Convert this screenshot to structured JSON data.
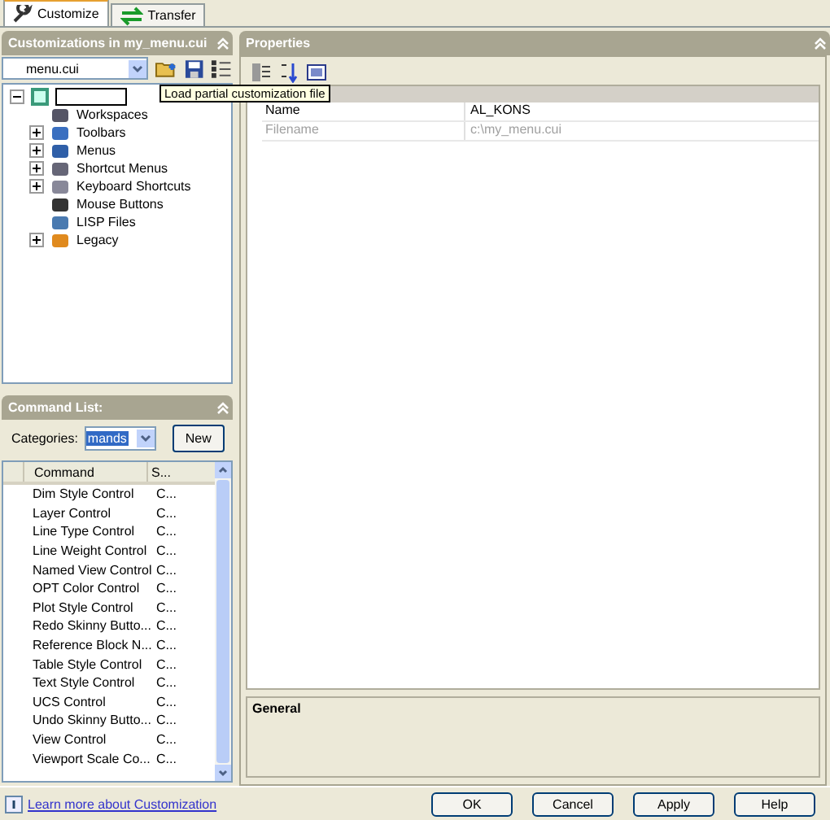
{
  "tabs": [
    {
      "label": "Customize",
      "selected": true
    },
    {
      "label": "Transfer",
      "selected": false
    }
  ],
  "customizations": {
    "title": "Customizations in my_menu.cui",
    "file_combo": {
      "value": "menu.cui"
    },
    "tooltip": "Load partial customization file",
    "tree": {
      "expanded": true,
      "children": [
        {
          "label": "Workspaces",
          "kind": "leaf"
        },
        {
          "label": "Toolbars",
          "kind": "group"
        },
        {
          "label": "Menus",
          "kind": "group"
        },
        {
          "label": "Shortcut Menus",
          "kind": "group"
        },
        {
          "label": "Keyboard Shortcuts",
          "kind": "group"
        },
        {
          "label": "Mouse Buttons",
          "kind": "leaf"
        },
        {
          "label": "LISP Files",
          "kind": "leaf"
        },
        {
          "label": "Legacy",
          "kind": "group"
        }
      ]
    }
  },
  "command_list": {
    "title": "Command List:",
    "categories_label": "Categories:",
    "categories_value": "mands",
    "new_button": "New",
    "columns": [
      "Command",
      "S..."
    ],
    "rows": [
      [
        "Dim Style Control",
        "C..."
      ],
      [
        "Layer Control",
        "C..."
      ],
      [
        "Line Type Control",
        "C..."
      ],
      [
        "Line Weight Control",
        "C..."
      ],
      [
        "Named View Control",
        "C..."
      ],
      [
        "OPT Color Control",
        "C..."
      ],
      [
        "Plot Style Control",
        "C..."
      ],
      [
        "Redo Skinny Butto...",
        "C..."
      ],
      [
        "Reference Block N...",
        "C..."
      ],
      [
        "Table Style Control",
        "C..."
      ],
      [
        "Text Style Control",
        "C..."
      ],
      [
        "UCS Control",
        "C..."
      ],
      [
        "Undo Skinny Butto...",
        "C..."
      ],
      [
        "View Control",
        "C..."
      ],
      [
        "Viewport Scale Co...",
        "C..."
      ]
    ]
  },
  "properties": {
    "title": "Properties",
    "rows": [
      {
        "name": "Name",
        "value": "AL_KONS",
        "disabled": false
      },
      {
        "name": "Filename",
        "value": "c:\\my_menu.cui",
        "disabled": true
      }
    ],
    "description_title": "General"
  },
  "footer": {
    "link": "Learn more about Customization",
    "buttons": [
      "OK",
      "Cancel",
      "Apply",
      "Help"
    ]
  }
}
